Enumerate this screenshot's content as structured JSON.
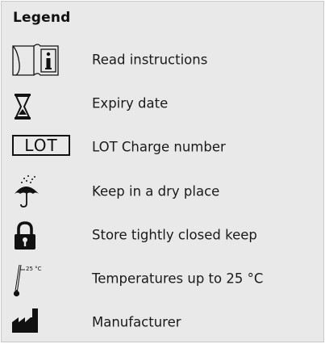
{
  "legend": {
    "title": "Legend",
    "items": [
      {
        "icon": "read-instructions-icon",
        "label": "Read instructions"
      },
      {
        "icon": "hourglass-icon",
        "label": "Expiry date"
      },
      {
        "icon": "lot-icon",
        "icon_text": "LOT",
        "label": "LOT Charge number"
      },
      {
        "icon": "umbrella-rain-icon",
        "label": "Keep in a dry place"
      },
      {
        "icon": "padlock-icon",
        "label": "Store tightly closed keep"
      },
      {
        "icon": "thermometer-icon",
        "icon_text": "25 °C",
        "label": "Temperatures up to 25 °C"
      },
      {
        "icon": "factory-icon",
        "label": "Manufacturer"
      }
    ]
  },
  "colors": {
    "panel_background": "#e9e9e9",
    "text": "#1a1a1a",
    "icon": "#111111"
  }
}
